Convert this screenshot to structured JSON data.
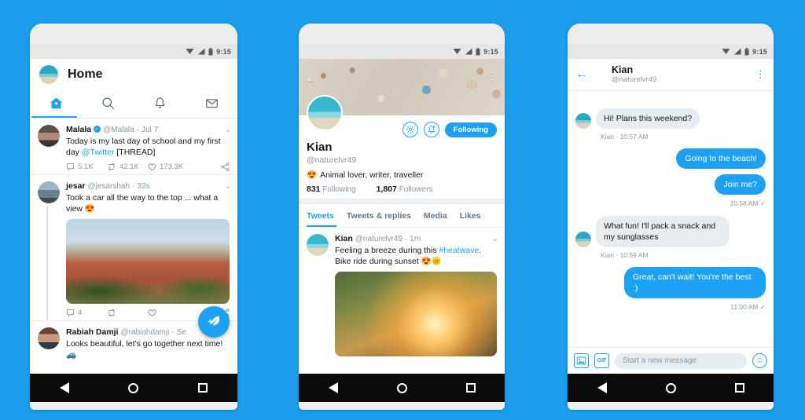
{
  "theme": {
    "background": "#1C9DEB",
    "accent": "#1DA1F2",
    "text": "#14171A",
    "muted": "#8899A6"
  },
  "statusbar": {
    "time": "9:15",
    "wifi_icon": "wifi-icon",
    "signal_icon": "signal-icon",
    "battery_icon": "battery-icon"
  },
  "navbar": {
    "back": "back-triangle-icon",
    "home": "home-circle-icon",
    "recents": "recents-square-icon"
  },
  "home_screen": {
    "title": "Home",
    "avatar_name": "user-avatar",
    "tabs": [
      {
        "name": "tab-home",
        "icon": "home-icon",
        "active": true
      },
      {
        "name": "tab-search",
        "icon": "search-icon",
        "active": false
      },
      {
        "name": "tab-notifications",
        "icon": "bell-icon",
        "active": false
      },
      {
        "name": "tab-messages",
        "icon": "envelope-icon",
        "active": false
      }
    ],
    "compose_button": "compose-tweet-fab",
    "tweets": [
      {
        "name": "Malala",
        "verified": true,
        "handle": "@Malala",
        "dot": "·",
        "time": "Jul 7",
        "text_before": "Today is my last day of school and my first day ",
        "link": "@Twitter",
        "text_after": " [THREAD]",
        "replies": "5.1K",
        "retweets": "42.1K",
        "likes": "173.3K",
        "has_image": false
      },
      {
        "name": "jesar",
        "verified": false,
        "handle": "@jesarshah",
        "dot": "·",
        "time": "32s",
        "text_before": "Took a car all the way to the top ... what a view 😍",
        "link": "",
        "text_after": "",
        "replies": "4",
        "retweets": "",
        "likes": "",
        "has_image": true,
        "image_name": "prague-cityscape-photo"
      },
      {
        "name": "Rabiah Damji",
        "verified": false,
        "handle": "@rabiahdamji",
        "dot": "·",
        "time": "Se",
        "text_before": "Looks beautiful, let's go together next time! 🚙",
        "link": "",
        "text_after": "",
        "replies": "",
        "retweets": "",
        "likes": "",
        "has_image": false
      }
    ]
  },
  "profile_screen": {
    "cover_photo": "seashells-beach-cover-photo",
    "back_icon": "back-arrow-icon",
    "more_icon": "overflow-menu-icon",
    "avatar_name": "profile-avatar",
    "settings_icon": "gear-icon",
    "notify_icon": "bell-add-icon",
    "follow_label": "Following",
    "name": "Kian",
    "handle": "@naturelvr49",
    "bio_emoji": "😍",
    "bio": "Animal lover, writer, traveller",
    "following_count": "831",
    "following_label": "Following",
    "followers_count": "1,807",
    "followers_label": "Followers",
    "tabs": [
      "Tweets",
      "Tweets & replies",
      "Media",
      "Likes"
    ],
    "active_tab": "Tweets",
    "tweet": {
      "name": "Kian",
      "handle": "@naturelvr49",
      "dot": "·",
      "time": "1m",
      "text_before": "Feeling a breeze during this ",
      "link": "#heatwave",
      "text_after": ". Bike ride during sunset 😍🌞",
      "image_name": "bike-sunset-photo"
    }
  },
  "chat_screen": {
    "back_icon": "back-arrow-icon",
    "name": "Kian",
    "handle": "@naturelvr49",
    "more_icon": "overflow-menu-icon",
    "messages": [
      {
        "type": "incoming",
        "text": "Hi! Plans this weekend?",
        "meta": "Kian · 10:57 AM"
      },
      {
        "type": "outgoing",
        "text": "Going to the beach!",
        "meta": ""
      },
      {
        "type": "outgoing",
        "text": "Join me?",
        "meta": "10:58 AM ✓"
      },
      {
        "type": "incoming",
        "text": "What fun! I'll pack a snack and my sunglasses",
        "meta": "Kian · 10:59 AM"
      },
      {
        "type": "outgoing",
        "text": "Great, can't wait! You're the best :)",
        "meta": "11:00 AM ✓"
      }
    ],
    "composer": {
      "image_button": "image-attach-icon",
      "gif_button": "GIF",
      "placeholder": "Start a new message",
      "emoji_button": "emoji-icon"
    }
  }
}
